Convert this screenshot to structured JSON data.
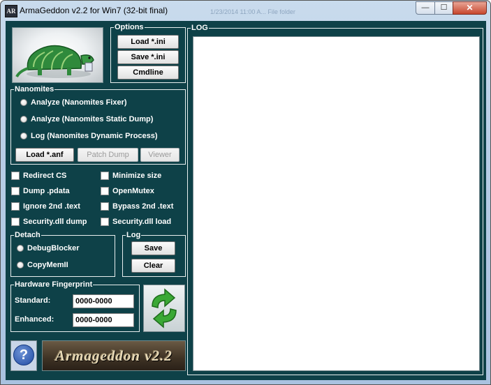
{
  "window": {
    "title": "ArmaGeddon v2.2 for Win7 (32-bit final)",
    "icon_text": "AR",
    "background_ghost": "1/23/2014 11:00 A...      File folder",
    "controls": {
      "minimize": "—",
      "maximize": "☐",
      "close": "✕"
    }
  },
  "options": {
    "label": "Options",
    "buttons": [
      "Load *.ini",
      "Save *.ini",
      "Cmdline"
    ]
  },
  "nanomites": {
    "label": "Nanomites",
    "radios": [
      "Analyze (Nanomites Fixer)",
      "Analyze (Nanomites Static Dump)",
      "Log (Nanomites Dynamic Process)"
    ],
    "buttons": {
      "load": "Load *.anf",
      "patch": "Patch Dump",
      "viewer": "Viewer"
    }
  },
  "checkboxes_left": [
    "Redirect CS",
    "Dump .pdata",
    "Ignore 2nd .text",
    "Security.dll dump"
  ],
  "checkboxes_right": [
    "Minimize size",
    "OpenMutex",
    "Bypass 2nd .text",
    "Security.dll load"
  ],
  "detach": {
    "label": "Detach",
    "radios": [
      "DebugBlocker",
      "CopyMemII"
    ]
  },
  "log_group": {
    "label": "Log",
    "buttons": [
      "Save",
      "Clear"
    ]
  },
  "fingerprint": {
    "label": "Hardware Fingerprint",
    "standard_label": "Standard:",
    "standard_value": "0000-0000",
    "enhanced_label": "Enhanced:",
    "enhanced_value": "0000-0000"
  },
  "log_panel": {
    "label": "LOG"
  },
  "banner": {
    "text": "Armageddon v2.2"
  },
  "help": {
    "glyph": "?"
  },
  "colors": {
    "panel": "#0e4148",
    "frame": "#e8efef"
  }
}
